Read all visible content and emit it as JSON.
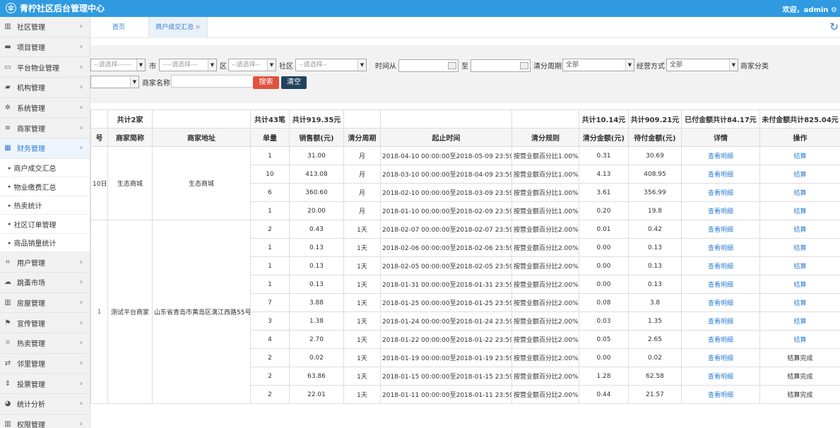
{
  "header": {
    "title": "青柠社区后台管理中心",
    "user": "欢迎，admin ⚙"
  },
  "sidebar": {
    "items": [
      {
        "label": "社区管理",
        "icon": "building-icon"
      },
      {
        "label": "项目管理",
        "icon": "project-icon"
      },
      {
        "label": "平台物业管理",
        "icon": "monitor-icon"
      },
      {
        "label": "机构管理",
        "icon": "stripe-icon"
      },
      {
        "label": "系统管理",
        "icon": "cog-icon"
      },
      {
        "label": "商家管理",
        "icon": "list-icon"
      },
      {
        "label": "财务管理",
        "icon": "calculator-icon",
        "active": true
      }
    ],
    "subitems": [
      "商户成交汇总",
      "物业缴费汇总",
      "热卖统计",
      "社区订单管理",
      "商品销量统计"
    ],
    "items2": [
      {
        "label": "用户管理",
        "icon": "crop-icon"
      },
      {
        "label": "跳蚤市场",
        "icon": "cloud-icon"
      },
      {
        "label": "房屋管理",
        "icon": "bank-icon"
      },
      {
        "label": "宣传管理",
        "icon": "flag-icon"
      },
      {
        "label": "热卖管理",
        "icon": "sun-icon"
      },
      {
        "label": "邻里管理",
        "icon": "retweet-icon"
      },
      {
        "label": "投票管理",
        "icon": "sort-icon"
      },
      {
        "label": "统计分析",
        "icon": "pie-icon"
      },
      {
        "label": "权限管理",
        "icon": "bank-icon"
      }
    ]
  },
  "tabs": {
    "home": "首页",
    "current": "商户成交汇总"
  },
  "filter": {
    "province_placeholder": "--请选择------",
    "city_label": "市",
    "city_placeholder": "----请选择---",
    "district_label": "区",
    "district_placeholder": "--请选择--",
    "community_label": "社区",
    "community_placeholder": "--请选择--",
    "time_from_label": "时间从",
    "time_to_label": "至",
    "cycle_label": "清分周期",
    "cycle_value": "全部",
    "mode_label": "经营方式",
    "mode_value": "全部",
    "category_label": "商家分类",
    "name_label": "商家名称",
    "search": "搜索",
    "clear": "清空"
  },
  "summary": {
    "merchants": "共计2家",
    "orders": "共计43笔",
    "sales": "共计919.35元",
    "clear_amount": "共计10.14元",
    "pending": "共计909.21元",
    "paid": "已付金额共计84.17元",
    "unpaid": "未付金额共计825.04元"
  },
  "columns": [
    "号",
    "商家简称",
    "商家地址",
    "单量",
    "销售额(元)",
    "清分周期",
    "起止时间",
    "清分规则",
    "清分金额(元)",
    "待付金额(元)",
    "详情",
    "操作"
  ],
  "groups": [
    {
      "date": "10日",
      "name": "生态商城",
      "addr": "生态商城",
      "rows": [
        [
          "1",
          "31.00",
          "月",
          "2018-04-10 00:00:00至2018-05-09 23:59:59",
          "按营业额百分比1.00%",
          "0.31",
          "30.69",
          "查看明细",
          "结算"
        ],
        [
          "10",
          "413.08",
          "月",
          "2018-03-10 00:00:00至2018-04-09 23:59:59",
          "按营业额百分比1.00%",
          "4.13",
          "408.95",
          "查看明细",
          "结算"
        ],
        [
          "6",
          "360.60",
          "月",
          "2018-02-10 00:00:00至2018-03-09 23:59:59",
          "按营业额百分比1.00%",
          "3.61",
          "356.99",
          "查看明细",
          "结算"
        ],
        [
          "1",
          "20.00",
          "月",
          "2018-01-10 00:00:00至2018-02-09 23:59:59",
          "按营业额百分比1.00%",
          "0.20",
          "19.8",
          "查看明细",
          "结算"
        ]
      ]
    },
    {
      "date": "1",
      "name": "测试平台商家",
      "addr": "山东省青岛市黄岛区漓江西路55号",
      "rows": [
        [
          "2",
          "0.43",
          "1天",
          "2018-02-07 00:00:00至2018-02-07 23:59:59",
          "按营业额百分比2.00%",
          "0.01",
          "0.42",
          "查看明细",
          "结算"
        ],
        [
          "1",
          "0.13",
          "1天",
          "2018-02-06 00:00:00至2018-02-06 23:59:59",
          "按营业额百分比2.00%",
          "0.00",
          "0.13",
          "查看明细",
          "结算"
        ],
        [
          "1",
          "0.13",
          "1天",
          "2018-02-05 00:00:00至2018-02-05 23:59:59",
          "按营业额百分比2.00%",
          "0.00",
          "0.13",
          "查看明细",
          "结算"
        ],
        [
          "1",
          "0.13",
          "1天",
          "2018-01-31 00:00:00至2018-01-31 23:59:59",
          "按营业额百分比2.00%",
          "0.00",
          "0.13",
          "查看明细",
          "结算"
        ],
        [
          "7",
          "3.88",
          "1天",
          "2018-01-25 00:00:00至2018-01-25 23:59:59",
          "按营业额百分比2.00%",
          "0.08",
          "3.8",
          "查看明细",
          "结算"
        ],
        [
          "3",
          "1.38",
          "1天",
          "2018-01-24 00:00:00至2018-01-24 23:59:59",
          "按营业额百分比2.00%",
          "0.03",
          "1.35",
          "查看明细",
          "结算"
        ],
        [
          "4",
          "2.70",
          "1天",
          "2018-01-22 00:00:00至2018-01-22 23:59:59",
          "按营业额百分比2.00%",
          "0.05",
          "2.65",
          "查看明细",
          "结算"
        ],
        [
          "2",
          "0.02",
          "1天",
          "2018-01-19 00:00:00至2018-01-19 23:59:59",
          "按营业额百分比2.00%",
          "0.00",
          "0.02",
          "查看明细",
          "结算完成"
        ],
        [
          "2",
          "63.86",
          "1天",
          "2018-01-15 00:00:00至2018-01-15 23:59:59",
          "按营业额百分比2.00%",
          "1.28",
          "62.58",
          "查看明细",
          "结算完成"
        ],
        [
          "2",
          "22.01",
          "1天",
          "2018-01-11 00:00:00至2018-01-11 23:59:59",
          "按营业额百分比2.00%",
          "0.44",
          "21.57",
          "查看明细",
          "结算完成"
        ]
      ]
    }
  ]
}
